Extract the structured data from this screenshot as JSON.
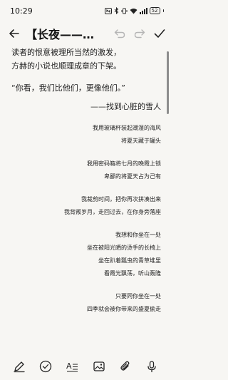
{
  "status_bar": {
    "time": "10:29",
    "battery": "52"
  },
  "toolbar": {
    "title": "【长夜——雪人】",
    "icons": [
      "back-arrow-icon",
      "undo-icon",
      "redo-icon",
      "check-icon"
    ]
  },
  "content": {
    "paragraph_1": "读者的恨意被理所当然的激发，",
    "paragraph_2": "方赫的小说也顺理成章的下架。",
    "quote": "“你看，我们比他们，更像他们。”",
    "signature": "——找到心脏的雪人",
    "poem": [
      [
        "我用玻璃杯装起潮湿的海风",
        "将夏天藏于罐头"
      ],
      [
        "我用密码箱将七月的晚霞上锁",
        "卑鄙的将夏天占为己有"
      ],
      [
        "我裁剪时间，把你再次拼凑出来",
        "我背叛岁月，走回过去，在你身旁落座"
      ],
      [
        "我想和你坐在一处",
        "坐在被阳光晒的烫手的长椅上",
        "坐在趴着瓢虫的青草堆里",
        "看霞光飘荡，听山轰隆"
      ],
      [
        "只要同你坐在一处",
        "四季就会被你带来的盛夏偷走"
      ]
    ]
  },
  "bottom_bar": {
    "icons": [
      "pen-icon",
      "checklist-icon",
      "text-format-icon",
      "image-icon",
      "attachment-icon",
      "microphone-icon"
    ]
  }
}
